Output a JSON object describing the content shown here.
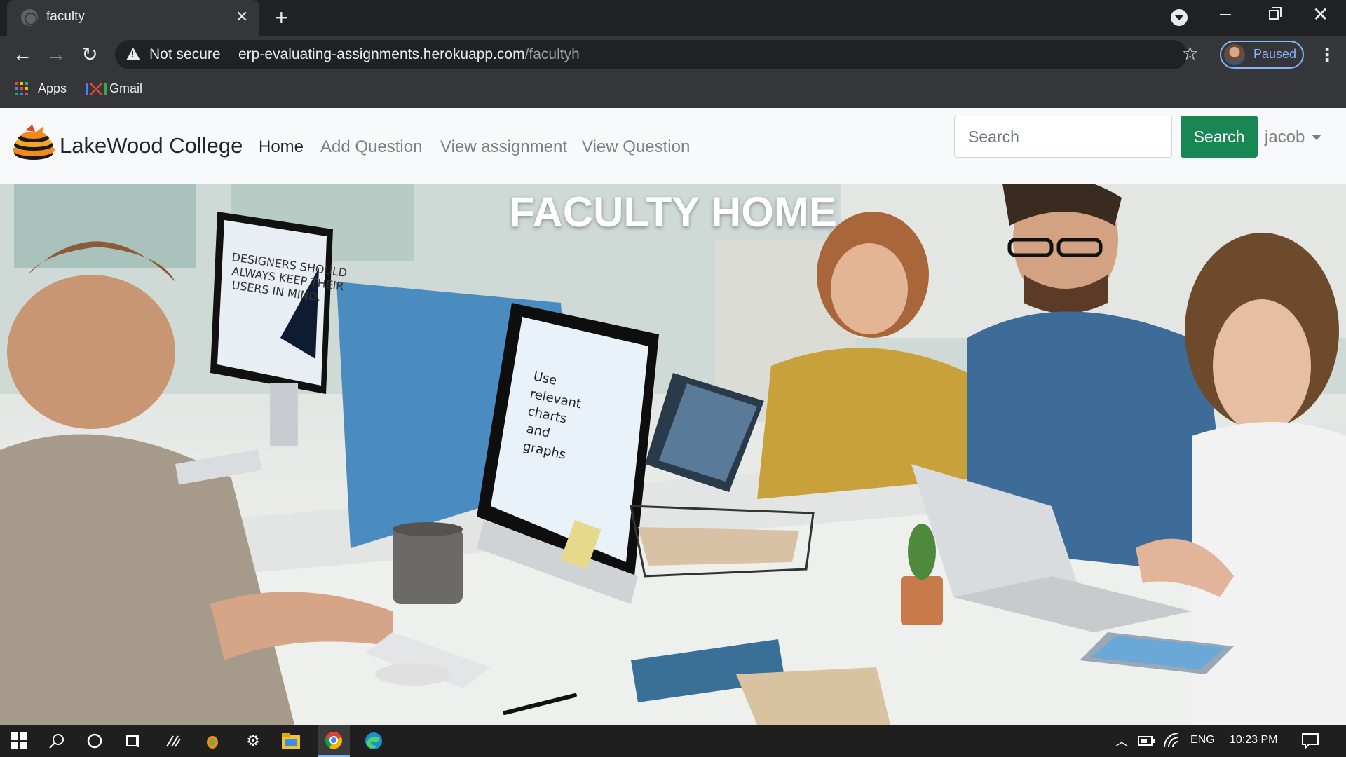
{
  "browser": {
    "tab_title": "faculty",
    "url_host": "erp-evaluating-assignments.herokuapp.com",
    "url_path": "/facultyh",
    "security_label": "Not secure",
    "profile_status": "Paused",
    "bookmarks": [
      {
        "label": "Apps",
        "icon": "apps-grid-icon"
      },
      {
        "label": "Gmail",
        "icon": "gmail-icon"
      }
    ]
  },
  "site": {
    "brand": "LakeWood College",
    "nav": [
      {
        "label": "Home",
        "active": true
      },
      {
        "label": "Add Question",
        "active": false
      },
      {
        "label": "View assignment",
        "active": false
      },
      {
        "label": "View Question",
        "active": false
      }
    ],
    "search_placeholder": "Search",
    "search_button": "Search",
    "user": "jacob"
  },
  "hero": {
    "title": "FACULTY HOME",
    "monitor_left_text": "DESIGNERS SHOULD ALWAYS KEEP THEIR USERS IN MIND.",
    "monitor_center_text": "Use relevant charts and graphs"
  },
  "taskbar": {
    "language": "ENG",
    "time": "10:23 PM"
  },
  "colors": {
    "search_button": "#198754",
    "chrome_dark": "#202124",
    "chrome_toolbar": "#35363a",
    "profile_accent": "#8ab4f8"
  }
}
